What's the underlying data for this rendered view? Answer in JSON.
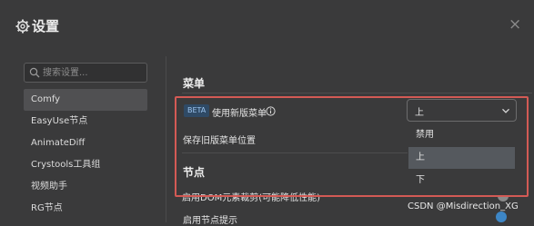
{
  "dialog": {
    "title": "设置",
    "close_glyph": "×"
  },
  "search": {
    "placeholder": "搜索设置..."
  },
  "sidebar": {
    "items": [
      {
        "label": "Comfy",
        "active": true
      },
      {
        "label": "EasyUse节点",
        "active": false
      },
      {
        "label": "AnimateDiff",
        "active": false
      },
      {
        "label": "Crystools工具组",
        "active": false
      },
      {
        "label": "视频助手",
        "active": false
      },
      {
        "label": "RG节点",
        "active": false
      }
    ]
  },
  "content": {
    "menu_section": "菜单",
    "beta_badge": "BETA",
    "new_menu_label": "使用新版菜单",
    "new_menu_value": "上",
    "save_menu_position_label": "保存旧版菜单位置",
    "dropdown_options": [
      {
        "label": "禁用",
        "selected": false
      },
      {
        "label": "上",
        "selected": true
      },
      {
        "label": "下",
        "selected": false
      }
    ],
    "node_section": "节点",
    "dom_clip_label": "启用DOM元素裁剪(可能降低性能)",
    "node_tips_label": "启用节点提示"
  },
  "watermark": "CSDN @Misdirection_XG",
  "colors": {
    "background": "#3a3a3b",
    "active_item": "#505052",
    "highlight_border": "#d35a55",
    "beta_bg": "#2f4a66",
    "beta_text": "#9cc4ef"
  },
  "icons": [
    "gear-icon",
    "close-icon",
    "search-icon",
    "info-icon",
    "chevron-down-icon"
  ]
}
